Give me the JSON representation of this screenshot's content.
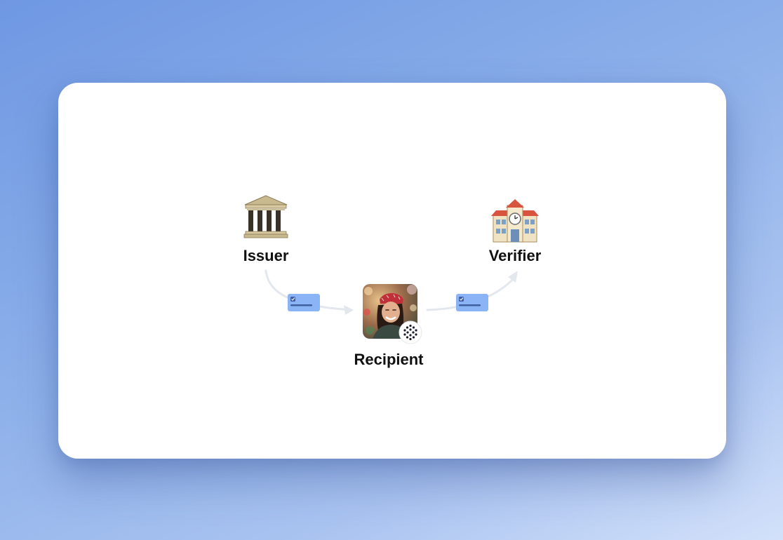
{
  "nodes": {
    "issuer": {
      "label": "Issuer",
      "icon": "classical-building-icon"
    },
    "verifier": {
      "label": "Verifier",
      "icon": "school-building-icon"
    },
    "recipient": {
      "label": "Recipient",
      "icon": "avatar-photo"
    }
  },
  "credential_icon": "credential-card-icon",
  "badge_icon": "wallet-badge-icon",
  "colors": {
    "background_start": "#6f98e3",
    "background_end": "#d3e1fa",
    "card": "#ffffff",
    "credential_card": "#8ab4f5",
    "credential_card_detail": "#3f5f9e",
    "arrow": "#e3e7ee",
    "label_text": "#111111"
  }
}
